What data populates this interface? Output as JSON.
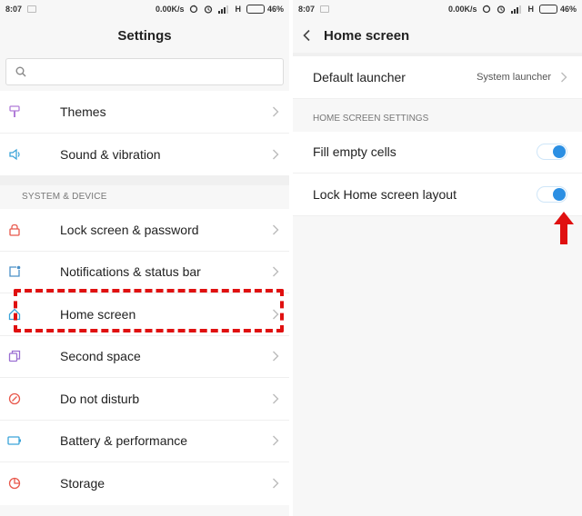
{
  "status_bar": {
    "time": "8:07",
    "speed": "0.00K/s",
    "network": "H",
    "battery": "46%",
    "battery_level": 0.46
  },
  "left": {
    "title": "Settings",
    "search": {
      "value": "",
      "placeholder": ""
    },
    "group1": [
      {
        "name": "themes",
        "label": "Themes",
        "icon": "brush-icon",
        "color": "#b07cd8"
      },
      {
        "name": "sound-vibration",
        "label": "Sound & vibration",
        "icon": "speaker-icon",
        "color": "#3ba4d9"
      }
    ],
    "section_header": "SYSTEM & DEVICE",
    "group2": [
      {
        "name": "lock-screen-password",
        "label": "Lock screen & password",
        "icon": "lock-icon",
        "color": "#e8584c"
      },
      {
        "name": "notifications-status-bar",
        "label": "Notifications & status bar",
        "icon": "notification-icon",
        "color": "#4a90c8"
      },
      {
        "name": "home-screen",
        "label": "Home screen",
        "icon": "home-icon",
        "color": "#3ba4d9"
      },
      {
        "name": "second-space",
        "label": "Second space",
        "icon": "second-space-icon",
        "color": "#9b6fd2"
      },
      {
        "name": "do-not-disturb",
        "label": "Do not disturb",
        "icon": "dnd-icon",
        "color": "#e8584c"
      },
      {
        "name": "battery-performance",
        "label": "Battery & performance",
        "icon": "battery-icon",
        "color": "#3ba4d9"
      },
      {
        "name": "storage",
        "label": "Storage",
        "icon": "pie-chart-icon",
        "color": "#e8584c"
      }
    ]
  },
  "right": {
    "title": "Home screen",
    "default_launcher": {
      "label": "Default launcher",
      "value": "System launcher"
    },
    "section_header": "HOME SCREEN SETTINGS",
    "toggles": [
      {
        "label": "Fill empty cells",
        "on": true
      },
      {
        "label": "Lock Home screen layout",
        "on": true
      }
    ]
  },
  "colors": {
    "accent": "#2b8fe3",
    "highlight": "#e01010"
  }
}
